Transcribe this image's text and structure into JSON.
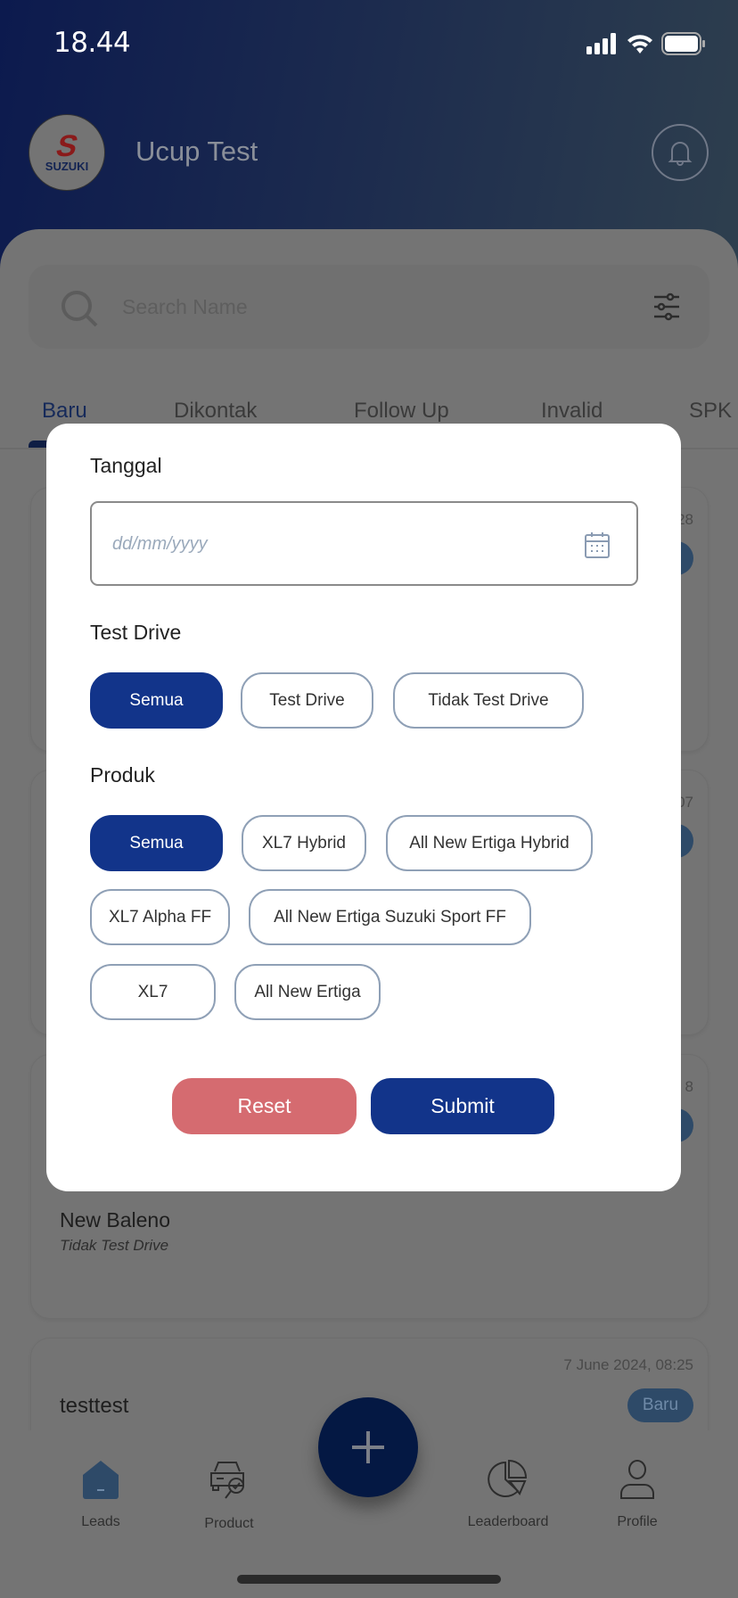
{
  "status_bar": {
    "time": "18.44"
  },
  "header": {
    "logo_text": "SUZUKI",
    "user_name": "Ucup Test"
  },
  "search": {
    "placeholder": "Search Name"
  },
  "tabs": [
    {
      "label": "Baru",
      "active": true
    },
    {
      "label": "Dikontak"
    },
    {
      "label": "Follow Up"
    },
    {
      "label": "Invalid"
    },
    {
      "label": "SPK"
    }
  ],
  "cards": [
    {
      "timestamp_fragment": "28"
    },
    {
      "timestamp_fragment": "07"
    },
    {
      "timestamp_fragment": "8",
      "model": "New Baleno",
      "test_drive": "Tidak Test Drive"
    },
    {
      "timestamp": "7 June 2024, 08:25",
      "name": "testtest",
      "status": "Baru"
    }
  ],
  "filter_modal": {
    "date_label": "Tanggal",
    "date_placeholder": "dd/mm/yyyy",
    "test_drive_label": "Test Drive",
    "test_drive_options": [
      "Semua",
      "Test Drive",
      "Tidak Test Drive"
    ],
    "test_drive_selected": "Semua",
    "product_label": "Produk",
    "product_options": [
      "Semua",
      "XL7 Hybrid",
      "All New Ertiga Hybrid",
      "XL7 Alpha FF",
      "All New Ertiga Suzuki Sport FF",
      "XL7",
      "All New Ertiga"
    ],
    "product_selected": "Semua",
    "reset_label": "Reset",
    "submit_label": "Submit"
  },
  "bottom_nav": [
    {
      "label": "Leads",
      "icon": "home-icon",
      "active": true
    },
    {
      "label": "Product",
      "icon": "car-search-icon"
    },
    {
      "label": "Leaderboard",
      "icon": "pie-chart-icon"
    },
    {
      "label": "Profile",
      "icon": "user-icon"
    }
  ],
  "colors": {
    "primary": "#12348a",
    "reset": "#d56b70",
    "chip_border": "#8fa0b6"
  }
}
